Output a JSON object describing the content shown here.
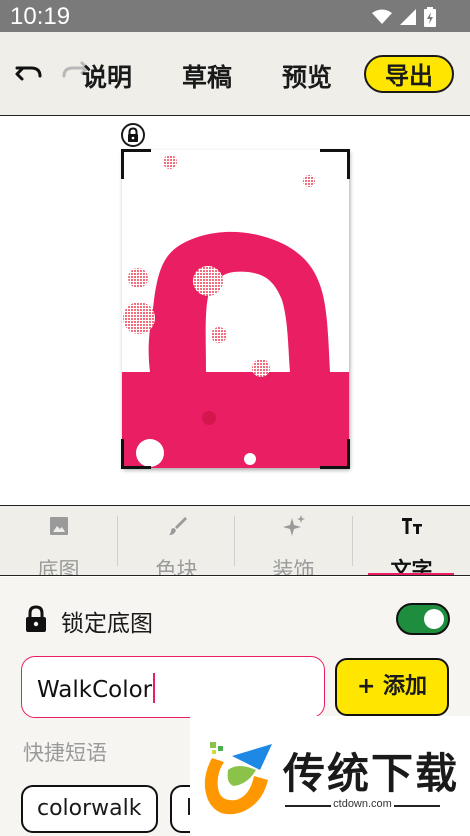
{
  "status_bar": {
    "time": "10:19",
    "icons": [
      "wifi-icon",
      "signal-icon",
      "battery-icon"
    ]
  },
  "toolbar": {
    "undo_icon": "undo-icon",
    "redo_icon": "redo-icon",
    "help_label": "说明",
    "draft_label": "草稿",
    "preview_label": "预览",
    "export_label": "导出"
  },
  "canvas": {
    "lock_icon": "lock-icon",
    "colors": {
      "accent": "#E91E63",
      "dots": "#F26D7D",
      "frame": "#111111"
    }
  },
  "tabs": [
    {
      "label": "底图",
      "icon": "image-icon"
    },
    {
      "label": "色块",
      "icon": "brush-icon"
    },
    {
      "label": "装饰",
      "icon": "sparkle-icon"
    },
    {
      "label": "文字",
      "icon": "text-icon",
      "active": true
    }
  ],
  "text_panel": {
    "lock_label": "锁定底图",
    "lock_enabled": true,
    "input_value": "WalkColor",
    "add_label": "+ 添加",
    "hint_label": "快捷短语",
    "chips": [
      "colorwalk",
      "b"
    ]
  },
  "colors": {
    "brand_yellow": "#FFE600",
    "accent_pink": "#E91E63",
    "toggle_green": "#1E8E3E",
    "toolbar_bg": "#EFEEE9"
  },
  "watermark": {
    "title": "传统下载",
    "url": "ctdown.com"
  }
}
